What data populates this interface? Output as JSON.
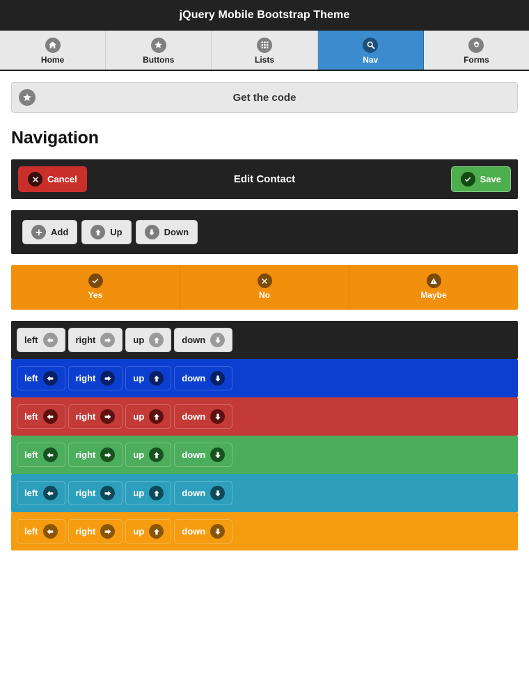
{
  "header": {
    "title": "jQuery Mobile Bootstrap Theme"
  },
  "tabs": [
    {
      "label": "Home",
      "icon": "home-icon",
      "active": false
    },
    {
      "label": "Buttons",
      "icon": "star-icon",
      "active": false
    },
    {
      "label": "Lists",
      "icon": "grid-icon",
      "active": false
    },
    {
      "label": "Nav",
      "icon": "search-icon",
      "active": true
    },
    {
      "label": "Forms",
      "icon": "gear-icon",
      "active": false
    }
  ],
  "collapsible": {
    "title": "Get the code",
    "icon": "star-icon"
  },
  "page_title": "Navigation",
  "edit_bar": {
    "title": "Edit Contact",
    "cancel_label": "Cancel",
    "cancel_icon": "delete-icon",
    "save_label": "Save",
    "save_icon": "check-icon"
  },
  "toolbar": {
    "buttons": [
      {
        "label": "Add",
        "icon": "plus-icon"
      },
      {
        "label": "Up",
        "icon": "arrow-up-icon"
      },
      {
        "label": "Down",
        "icon": "arrow-down-icon"
      }
    ]
  },
  "navbar": {
    "items": [
      {
        "label": "Yes",
        "icon": "check-icon"
      },
      {
        "label": "No",
        "icon": "delete-icon"
      },
      {
        "label": "Maybe",
        "icon": "alert-icon"
      }
    ]
  },
  "button_rows": {
    "labels": [
      {
        "label": "left",
        "icon": "arrow-left-icon"
      },
      {
        "label": "right",
        "icon": "arrow-right-icon"
      },
      {
        "label": "up",
        "icon": "arrow-up-icon"
      },
      {
        "label": "down",
        "icon": "arrow-down-icon"
      }
    ],
    "themes": [
      "dark",
      "blue",
      "red",
      "green",
      "teal",
      "orange"
    ]
  },
  "colors": {
    "header_bg": "#222222",
    "tab_active": "#3b8cce",
    "accent_orange": "#f28f0c",
    "cancel_red": "#c9302c",
    "save_green": "#4cae4c",
    "row_blue": "#0c3fd0",
    "row_red": "#c33a37",
    "row_green": "#4cad5c",
    "row_teal": "#2d9fbd",
    "row_orange": "#f59c10"
  }
}
